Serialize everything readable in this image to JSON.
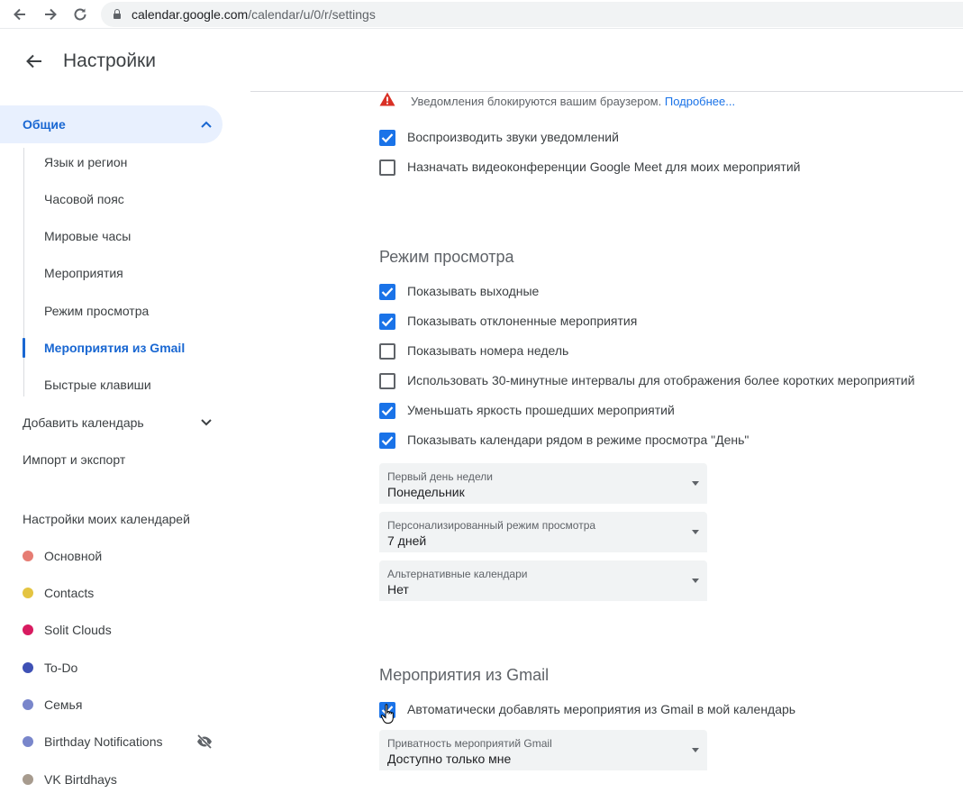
{
  "browser": {
    "url_domain": "calendar.google.com",
    "url_path": "/calendar/u/0/r/settings",
    "icons": [
      "back-arrow-icon",
      "forward-arrow-icon",
      "reload-icon",
      "lock-icon"
    ]
  },
  "header": {
    "title": "Настройки"
  },
  "sidebar": {
    "general": "Общие",
    "general_items": [
      "Язык и регион",
      "Часовой пояс",
      "Мировые часы",
      "Мероприятия",
      "Режим просмотра",
      "Мероприятия из Gmail",
      "Быстрые клавиши"
    ],
    "active_item": "Мероприятия из Gmail",
    "add_calendar": "Добавить календарь",
    "import_export": "Импорт и экспорт",
    "my_calendars_heading": "Настройки моих календарей",
    "calendars": [
      {
        "name": "Основной",
        "color": "#e67c73"
      },
      {
        "name": "Contacts",
        "color": "#e4c441"
      },
      {
        "name": "Solit Clouds",
        "color": "#d81b60"
      },
      {
        "name": "To-Do",
        "color": "#3f51b5"
      },
      {
        "name": "Семья",
        "color": "#7986cb"
      },
      {
        "name": "Birthday Notifications",
        "color": "#7986cb",
        "hidden": true
      },
      {
        "name": "VK Birtdhays",
        "color": "#a79b8e"
      }
    ]
  },
  "notifications": {
    "warning": "Уведомления блокируются вашим браузером.",
    "link": "Подробнее...",
    "options": [
      {
        "label": "Воспроизводить звуки уведомлений",
        "checked": true
      },
      {
        "label": "Назначать видеоконференции Google Meet для моих мероприятий",
        "checked": false
      }
    ]
  },
  "view_options": {
    "title": "Режим просмотра",
    "options": [
      {
        "label": "Показывать выходные",
        "checked": true
      },
      {
        "label": "Показывать отклоненные мероприятия",
        "checked": true
      },
      {
        "label": "Показывать номера недель",
        "checked": false
      },
      {
        "label": "Использовать 30-минутные интервалы для отображения более коротких мероприятий",
        "checked": false
      },
      {
        "label": "Уменьшать яркость прошедших мероприятий",
        "checked": true
      },
      {
        "label": "Показывать календари рядом в режиме просмотра \"День\"",
        "checked": true
      }
    ],
    "selects": [
      {
        "label": "Первый день недели",
        "value": "Понедельник"
      },
      {
        "label": "Персонализированный режим просмотра",
        "value": "7 дней"
      },
      {
        "label": "Альтернативные календари",
        "value": "Нет"
      }
    ]
  },
  "gmail_events": {
    "title": "Мероприятия из Gmail",
    "option": {
      "label": "Автоматически добавлять мероприятия из Gmail в мой календарь",
      "checked": true
    },
    "select": {
      "label": "Приватность мероприятий Gmail",
      "value": "Доступно только мне"
    }
  },
  "colors": {
    "accent": "#1a73e8",
    "active_nav_text": "#1967d2",
    "active_nav_bg": "#e8f0fe",
    "warning": "#d93025"
  }
}
